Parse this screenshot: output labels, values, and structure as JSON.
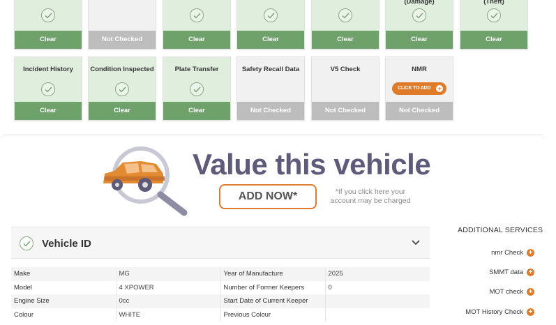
{
  "tiles_row1": [
    {
      "label": "",
      "status": "Clear"
    },
    {
      "label": "",
      "status": "Not Checked"
    },
    {
      "label": "",
      "status": "Clear"
    },
    {
      "label": "",
      "status": "Clear"
    },
    {
      "label": "",
      "status": "Clear"
    },
    {
      "label": "(Damage)",
      "status": "Clear"
    },
    {
      "label": "(Theft)",
      "status": "Clear"
    }
  ],
  "tiles_row2": [
    {
      "label": "Incident History",
      "status": "Clear"
    },
    {
      "label": "Condition Inspected",
      "status": "Clear"
    },
    {
      "label": "Plate Transfer",
      "status": "Clear"
    },
    {
      "label": "Safety Recall Data",
      "status": "Not Checked"
    },
    {
      "label": "V5 Check",
      "status": "Not Checked"
    },
    {
      "label": "NMR",
      "status": "Not Checked",
      "cta": "CLICK TO ADD"
    }
  ],
  "banner": {
    "title": "Value this vehicle",
    "button": "ADD NOW*",
    "note": "*If you click here your account may be charged"
  },
  "vehicle_panel": {
    "title": "Vehicle ID",
    "rows": [
      {
        "l1": "Make",
        "v1": "MG",
        "l2": "Year of Manufacture",
        "v2": "2025"
      },
      {
        "l1": "Model",
        "v1": "4 XPOWER",
        "l2": "Number of Former Keepers",
        "v2": "0"
      },
      {
        "l1": "Engine Size",
        "v1": "0cc",
        "l2": "Start Date of Current Keeper",
        "v2": ""
      },
      {
        "l1": "Colour",
        "v1": "WHITE",
        "l2": "Previous Colour",
        "v2": ""
      }
    ]
  },
  "additional_services": {
    "title": "ADDITIONAL SERVICES",
    "items": [
      "nmr Check",
      "SMMT data",
      "MOT check",
      "MOT History Check"
    ]
  },
  "colors": {
    "clear_green": "#6ea26a",
    "not_checked_grey": "#bdbdbd",
    "accent_orange": "#e07b2a",
    "title_purple": "#5e5a7a"
  }
}
